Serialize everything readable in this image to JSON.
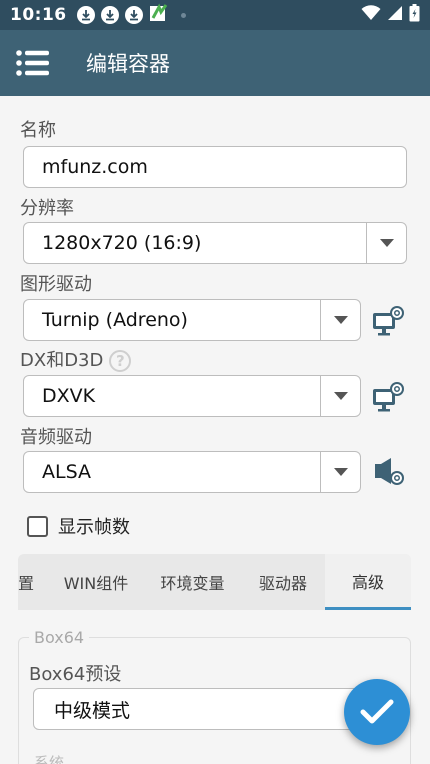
{
  "status": {
    "time": "10:16"
  },
  "appbar": {
    "title": "编辑容器"
  },
  "form": {
    "name_label": "名称",
    "name_value": "mfunz.com",
    "resolution_label": "分辨率",
    "resolution_value": "1280x720 (16:9)",
    "graphics_label": "图形驱动",
    "graphics_value": "Turnip (Adreno)",
    "dx_label": "DX和D3D",
    "dx_help": "?",
    "dx_value": "DXVK",
    "audio_label": "音频驱动",
    "audio_value": "ALSA",
    "show_fps_label": "显示帧数",
    "show_fps_checked": false
  },
  "tabs": [
    {
      "label": "置"
    },
    {
      "label": "WIN组件"
    },
    {
      "label": "环境变量"
    },
    {
      "label": "驱动器"
    },
    {
      "label": "高级",
      "active": true
    }
  ],
  "box64": {
    "legend": "Box64",
    "preset_label": "Box64预设",
    "preset_value": "中级模式"
  },
  "next_section_partial": "系统",
  "colors": {
    "statusbar": "#2f4d5f",
    "appbar": "#3e6275",
    "accent": "#3e8fc2",
    "fab": "#2d8fd5"
  },
  "icons": [
    "download-icon",
    "app-logo-icon",
    "wifi-icon",
    "signal-icon",
    "battery-icon",
    "menu-icon",
    "dropdown-arrow-icon",
    "display-settings-icon",
    "audio-settings-icon",
    "checkmark-icon"
  ]
}
